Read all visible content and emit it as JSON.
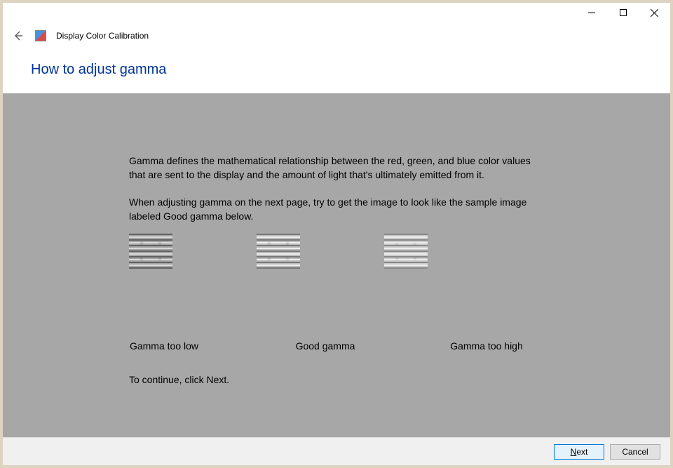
{
  "app": {
    "title": "Display Color Calibration"
  },
  "page": {
    "heading": "How to adjust gamma",
    "paragraph1": "Gamma defines the mathematical relationship between the red, green, and blue color values that are sent to the display and the amount of light that's ultimately emitted from it.",
    "paragraph2": "When adjusting gamma on the next page, try to get the image to look like the sample image labeled Good gamma below.",
    "continue_text": "To continue, click Next."
  },
  "samples": {
    "low_label": "Gamma too low",
    "good_label": "Good gamma",
    "high_label": "Gamma too high"
  },
  "buttons": {
    "next": "Next",
    "cancel": "Cancel"
  },
  "window_controls": {
    "minimize": "minimize",
    "maximize": "maximize",
    "close": "close"
  }
}
